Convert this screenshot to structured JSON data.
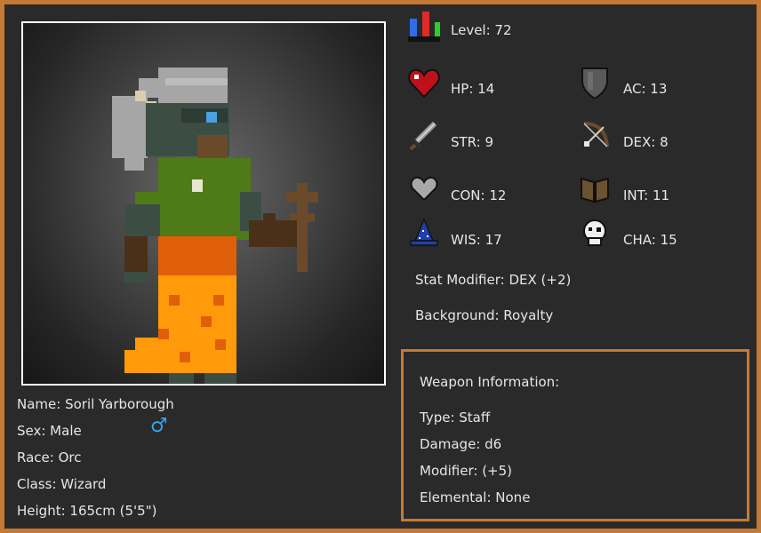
{
  "character": {
    "name": "Name: Soril Yarborough",
    "sex": "Sex: Male",
    "race": "Race: Orc",
    "class": "Class: Wizard",
    "height": "Height: 165cm (5'5\")",
    "sex_symbol": "♂"
  },
  "stats": {
    "level": "Level: 72",
    "hp": "HP: 14",
    "ac": "AC: 13",
    "str": "STR: 9",
    "dex": "DEX: 8",
    "con": "CON: 12",
    "int": "INT: 11",
    "wis": "WIS: 17",
    "cha": "CHA: 15",
    "modifier": "Stat Modifier: DEX (+2)",
    "background": "Background: Royalty"
  },
  "weapon": {
    "title": "Weapon Information:",
    "type": "Type: Staff",
    "damage": "Damage: d6",
    "modifier": "Modifier: (+5)",
    "elemental": "Elemental: None"
  },
  "colors": {
    "frame": "#c47a33",
    "panel": "#2a2a2a",
    "sex_symbol": "#3aa0e8"
  },
  "icons": {
    "level": "bar-chart-icon",
    "hp": "heart-icon",
    "ac": "shield-icon",
    "str": "sword-icon",
    "dex": "bow-icon",
    "con": "grey-heart-icon",
    "int": "book-icon",
    "wis": "wizard-hat-icon",
    "cha": "skull-icon"
  }
}
